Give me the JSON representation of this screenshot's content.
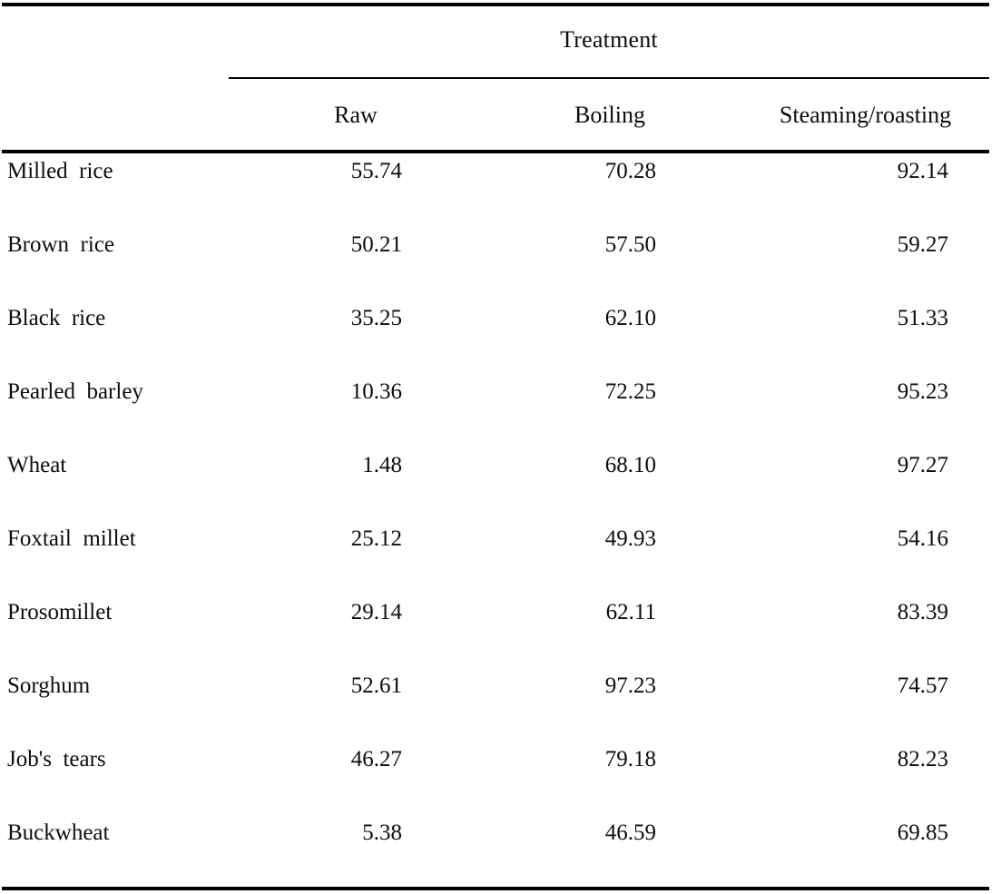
{
  "table": {
    "spanner_header": "Treatment",
    "stub_header": "",
    "columns": [
      {
        "label": "Raw"
      },
      {
        "label": "Boiling"
      },
      {
        "label": "Steaming/roasting"
      }
    ],
    "rows": [
      {
        "label": "Milled  rice",
        "raw": "55.74",
        "boiling": "70.28",
        "steaming": "92.14"
      },
      {
        "label": "Brown  rice",
        "raw": "50.21",
        "boiling": "57.50",
        "steaming": "59.27"
      },
      {
        "label": "Black  rice",
        "raw": "35.25",
        "boiling": "62.10",
        "steaming": "51.33"
      },
      {
        "label": "Pearled  barley",
        "raw": "10.36",
        "boiling": "72.25",
        "steaming": "95.23"
      },
      {
        "label": "Wheat",
        "raw": "1.48",
        "boiling": "68.10",
        "steaming": "97.27"
      },
      {
        "label": "Foxtail  millet",
        "raw": "25.12",
        "boiling": "49.93",
        "steaming": "54.16"
      },
      {
        "label": "Prosomillet",
        "raw": "29.14",
        "boiling": "62.11",
        "steaming": "83.39"
      },
      {
        "label": "Sorghum",
        "raw": "52.61",
        "boiling": "97.23",
        "steaming": "74.57"
      },
      {
        "label": "Job's  tears",
        "raw": "46.27",
        "boiling": "79.18",
        "steaming": "82.23"
      },
      {
        "label": "Buckwheat",
        "raw": "5.38",
        "boiling": "46.59",
        "steaming": "69.85"
      }
    ]
  },
  "chart_data": {
    "type": "table",
    "title": "Treatment",
    "categories": [
      "Milled rice",
      "Brown rice",
      "Black rice",
      "Pearled barley",
      "Wheat",
      "Foxtail millet",
      "Prosomillet",
      "Sorghum",
      "Job's tears",
      "Buckwheat"
    ],
    "series": [
      {
        "name": "Raw",
        "values": [
          55.74,
          50.21,
          35.25,
          10.36,
          1.48,
          25.12,
          29.14,
          52.61,
          46.27,
          5.38
        ]
      },
      {
        "name": "Boiling",
        "values": [
          70.28,
          57.5,
          62.1,
          72.25,
          68.1,
          49.93,
          62.11,
          97.23,
          79.18,
          46.59
        ]
      },
      {
        "name": "Steaming/roasting",
        "values": [
          92.14,
          59.27,
          51.33,
          95.23,
          97.27,
          54.16,
          83.39,
          74.57,
          82.23,
          69.85
        ]
      }
    ],
    "xlabel": "",
    "ylabel": "",
    "grid": false,
    "legend": "none"
  },
  "style": {
    "rule_color": "#000000",
    "text_color": "#0d0d0d",
    "background": "#ffffff"
  }
}
